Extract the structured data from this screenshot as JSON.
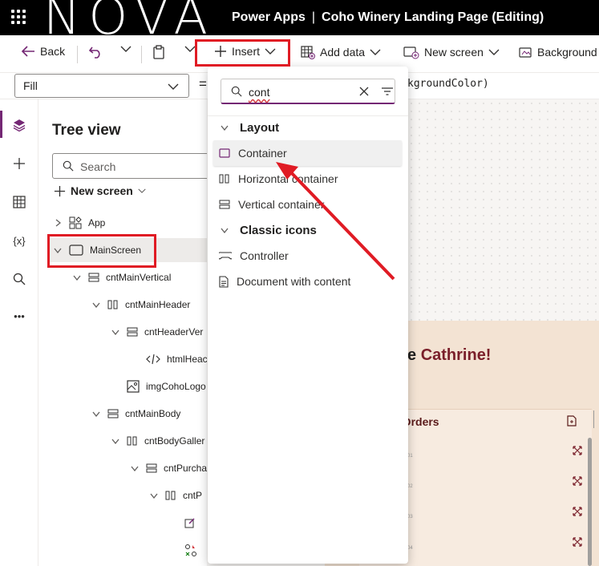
{
  "header": {
    "logo": "NOVA",
    "product": "Power Apps",
    "separator": "|",
    "app_title": "Coho Winery Landing Page (Editing)"
  },
  "commands": {
    "back": "Back",
    "insert": "Insert",
    "add_data": "Add data",
    "new_screen": "New screen",
    "background": "Background"
  },
  "formula_bar": {
    "property": "Fill",
    "equals": "=",
    "formula_fragment": "kgroundColor)"
  },
  "tree": {
    "title": "Tree view",
    "search_placeholder": "Search",
    "new_screen": "New screen",
    "nodes": [
      {
        "label": "App",
        "icon": "app-icon"
      },
      {
        "label": "MainScreen",
        "icon": "screen-icon"
      },
      {
        "label": "cntMainVertical",
        "icon": "vertical-container-icon"
      },
      {
        "label": "cntMainHeader",
        "icon": "horizontal-container-icon"
      },
      {
        "label": "cntHeaderVer",
        "icon": "vertical-container-icon"
      },
      {
        "label": "htmlHeac",
        "icon": "html-icon"
      },
      {
        "label": "imgCohoLogo",
        "icon": "image-icon"
      },
      {
        "label": "cntMainBody",
        "icon": "vertical-container-icon"
      },
      {
        "label": "cntBodyGaller",
        "icon": "horizontal-container-icon"
      },
      {
        "label": "cntPurcha",
        "icon": "vertical-container-icon"
      },
      {
        "label": "cntP",
        "icon": "horizontal-container-icon"
      }
    ]
  },
  "insert_menu": {
    "query": "cont",
    "groups": [
      {
        "label": "Layout",
        "items": [
          "Container",
          "Horizontal container",
          "Vertical container"
        ]
      },
      {
        "label": "Classic icons",
        "items": [
          "Controller",
          "Document with content"
        ]
      }
    ]
  },
  "canvas": {
    "welcome_prefix": "ome ",
    "welcome_name": "Cathrine!",
    "orders_title": "e Orders",
    "row_codes": [
      "01",
      "02",
      "03",
      "04"
    ]
  },
  "colors": {
    "accent": "#742774",
    "highlight": "#e01b24",
    "name_color": "#7a1f2a"
  }
}
